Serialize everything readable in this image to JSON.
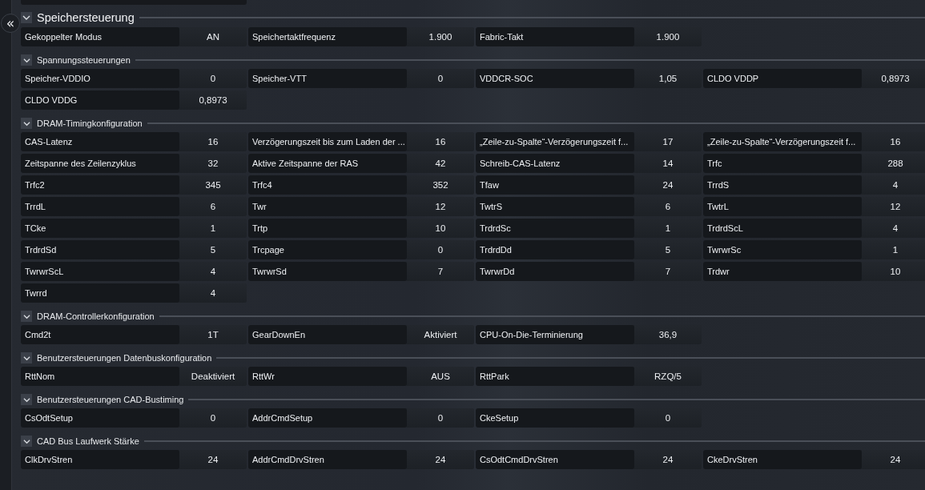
{
  "sidebar": {
    "collapse_button": "«"
  },
  "title_section": {
    "title": "Speichersteuerung",
    "expanded": true,
    "rows": [
      {
        "label": "Gekoppelter Modus",
        "value": "AN"
      },
      {
        "label": "Speichertaktfrequenz",
        "value": "1.900"
      },
      {
        "label": "Fabric-Takt",
        "value": "1.900"
      }
    ]
  },
  "sections": [
    {
      "title": "Spannungssteuerungen",
      "expanded": true,
      "items": [
        {
          "label": "Speicher-VDDIO",
          "value": "0"
        },
        {
          "label": "Speicher-VTT",
          "value": "0"
        },
        {
          "label": "VDDCR-SOC",
          "value": "1,05"
        },
        {
          "label": "CLDO VDDP",
          "value": "0,8973"
        },
        {
          "label": "CLDO VDDG",
          "value": "0,8973"
        }
      ]
    },
    {
      "title": "DRAM-Timingkonfiguration",
      "expanded": true,
      "items": [
        {
          "label": "CAS-Latenz",
          "value": "16"
        },
        {
          "label": "Verzögerungszeit bis zum Laden der ...",
          "value": "16"
        },
        {
          "label": "„Zeile-zu-Spalte“-Verzögerungszeit f...",
          "value": "17"
        },
        {
          "label": "„Zeile-zu-Spalte“-Verzögerungszeit f...",
          "value": "16"
        },
        {
          "label": "Zeitspanne des Zeilenzyklus",
          "value": "32"
        },
        {
          "label": "Aktive Zeitspanne der RAS",
          "value": "42"
        },
        {
          "label": "Schreib-CAS-Latenz",
          "value": "14"
        },
        {
          "label": "Trfc",
          "value": "288"
        },
        {
          "label": "Trfc2",
          "value": "345"
        },
        {
          "label": "Trfc4",
          "value": "352"
        },
        {
          "label": "Tfaw",
          "value": "24"
        },
        {
          "label": "TrrdS",
          "value": "4"
        },
        {
          "label": "TrrdL",
          "value": "6"
        },
        {
          "label": "Twr",
          "value": "12"
        },
        {
          "label": "TwtrS",
          "value": "6"
        },
        {
          "label": "TwtrL",
          "value": "12"
        },
        {
          "label": "TCke",
          "value": "1"
        },
        {
          "label": "Trtp",
          "value": "10"
        },
        {
          "label": "TrdrdSc",
          "value": "1"
        },
        {
          "label": "TrdrdScL",
          "value": "4"
        },
        {
          "label": "TrdrdSd",
          "value": "5"
        },
        {
          "label": "Trcpage",
          "value": "0"
        },
        {
          "label": "TrdrdDd",
          "value": "5"
        },
        {
          "label": "TwrwrSc",
          "value": "1"
        },
        {
          "label": "TwrwrScL",
          "value": "4"
        },
        {
          "label": "TwrwrSd",
          "value": "7"
        },
        {
          "label": "TwrwrDd",
          "value": "7"
        },
        {
          "label": "Trdwr",
          "value": "10"
        },
        {
          "label": "Twrrd",
          "value": "4"
        }
      ]
    },
    {
      "title": "DRAM-Controllerkonfiguration",
      "expanded": true,
      "items": [
        {
          "label": "Cmd2t",
          "value": "1T"
        },
        {
          "label": "GearDownEn",
          "value": "Aktiviert"
        },
        {
          "label": "CPU-On-Die-Terminierung",
          "value": "36,9"
        }
      ]
    },
    {
      "title": "Benutzersteuerungen Datenbuskonfiguration",
      "expanded": true,
      "items": [
        {
          "label": "RttNom",
          "value": "Deaktiviert"
        },
        {
          "label": "RttWr",
          "value": "AUS"
        },
        {
          "label": "RttPark",
          "value": "RZQ/5"
        }
      ]
    },
    {
      "title": "Benutzersteuerungen CAD-Bustiming",
      "expanded": true,
      "items": [
        {
          "label": "CsOdtSetup",
          "value": "0"
        },
        {
          "label": "AddrCmdSetup",
          "value": "0"
        },
        {
          "label": "CkeSetup",
          "value": "0"
        }
      ]
    },
    {
      "title": "CAD Bus Laufwerk Stärke",
      "expanded": true,
      "items": [
        {
          "label": "ClkDrvStren",
          "value": "24"
        },
        {
          "label": "AddrCmdDrvStren",
          "value": "24"
        },
        {
          "label": "CsOdtCmdDrvStren",
          "value": "24"
        },
        {
          "label": "CkeDrvStren",
          "value": "24"
        }
      ]
    }
  ]
}
